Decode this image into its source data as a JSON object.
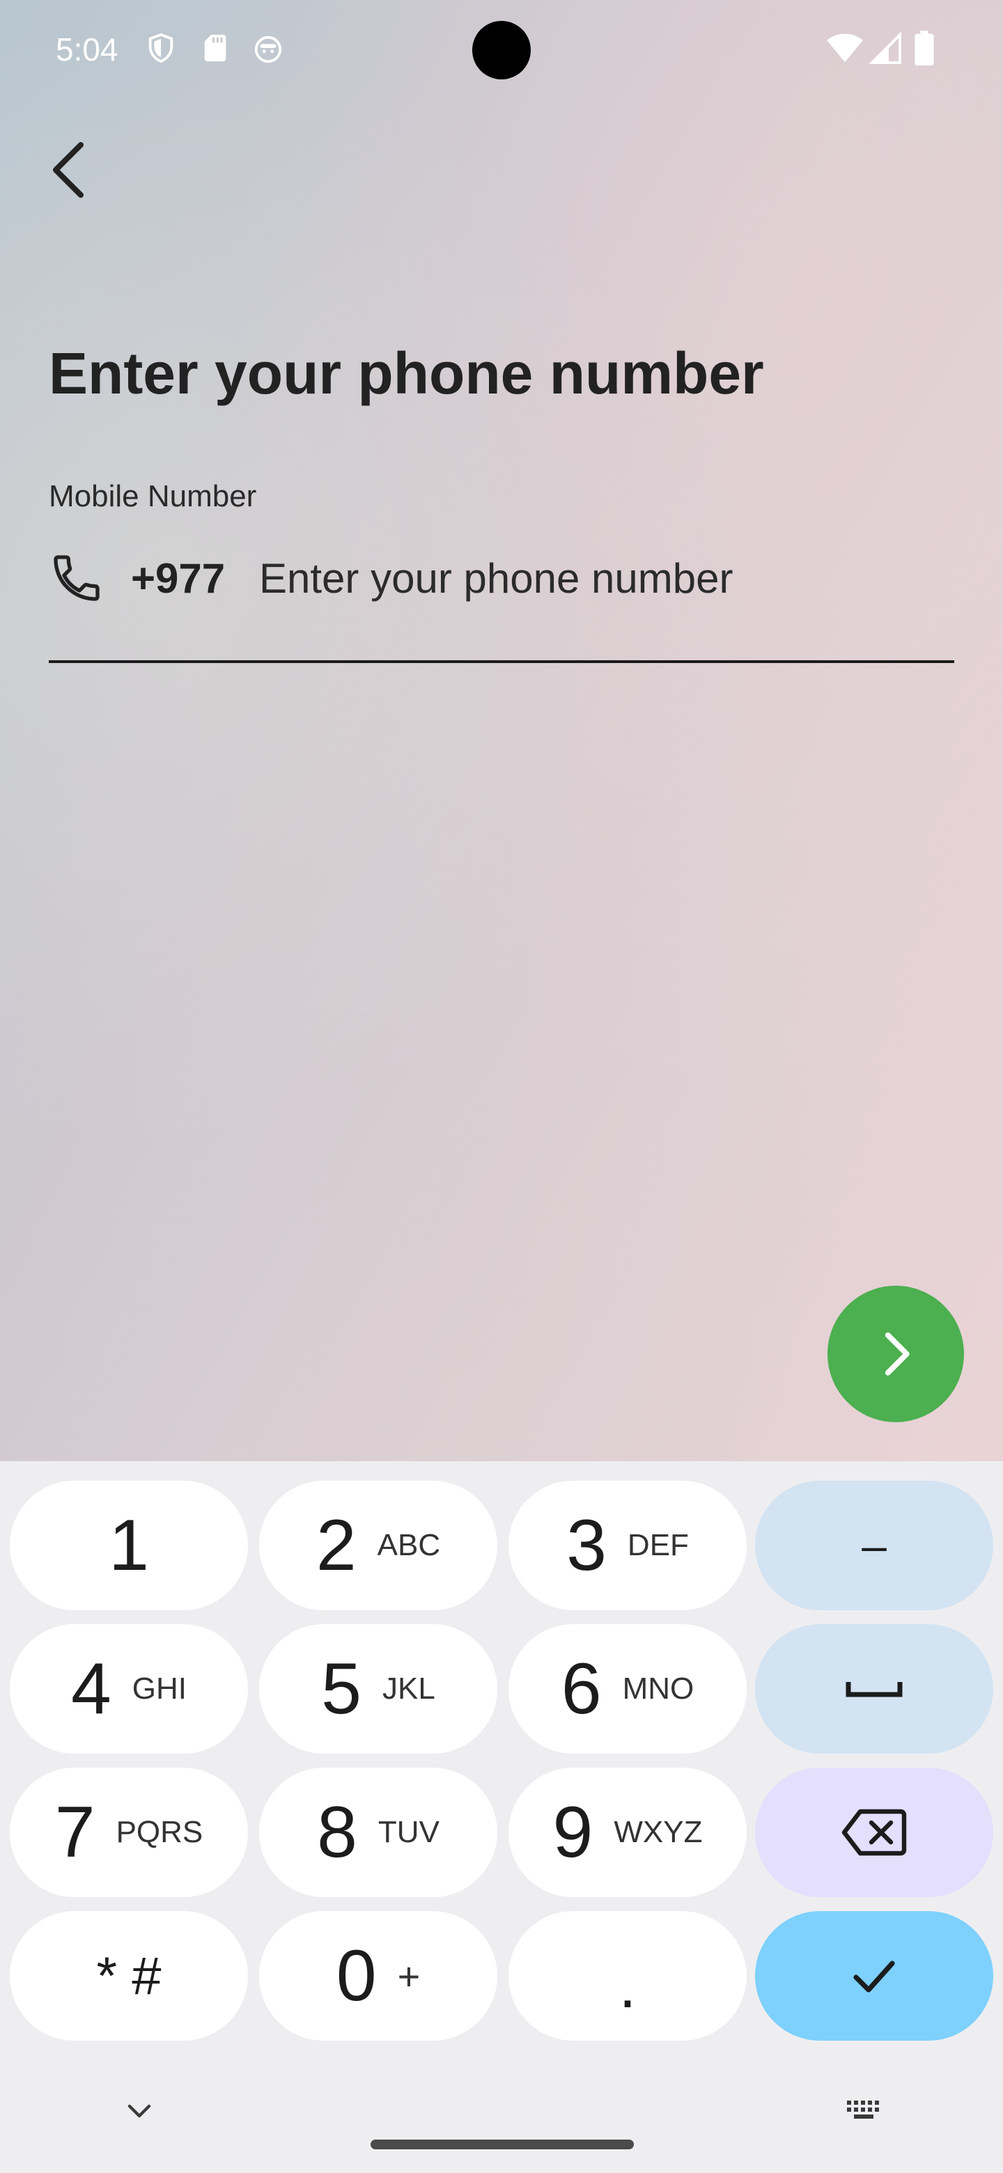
{
  "status_bar": {
    "time": "5:04",
    "icons_left": [
      "vpn-shield-icon",
      "sd-card-icon",
      "android-face-icon"
    ],
    "icons_right": [
      "wifi-icon",
      "cell-signal-icon",
      "battery-icon"
    ]
  },
  "header": {
    "back_icon": "chevron-left-icon"
  },
  "page": {
    "title": "Enter your phone number",
    "field_label": "Mobile Number",
    "country_code": "+977",
    "input_value": "",
    "input_placeholder": "Enter your phone number",
    "phone_icon": "phone-icon"
  },
  "fab": {
    "icon": "chevron-right-icon",
    "color": "#4caf50"
  },
  "keyboard": {
    "rows": [
      [
        {
          "num": "1",
          "letters": ""
        },
        {
          "num": "2",
          "letters": "ABC"
        },
        {
          "num": "3",
          "letters": "DEF"
        },
        {
          "sym": "–"
        }
      ],
      [
        {
          "num": "4",
          "letters": "GHI"
        },
        {
          "num": "5",
          "letters": "JKL"
        },
        {
          "num": "6",
          "letters": "MNO"
        },
        {
          "sym": "space"
        }
      ],
      [
        {
          "num": "7",
          "letters": "PQRS"
        },
        {
          "num": "8",
          "letters": "TUV"
        },
        {
          "num": "9",
          "letters": "WXYZ"
        },
        {
          "sym": "backspace"
        }
      ],
      [
        {
          "sym": "* #"
        },
        {
          "num": "0",
          "letters": "+"
        },
        {
          "sym": "."
        },
        {
          "sym": "done"
        }
      ]
    ],
    "dash_label": "–",
    "star_hash_label": "* #",
    "dot_label": ".",
    "colors": {
      "function_key": "#d3e3f2",
      "backspace_key": "#e3dffc",
      "done_key": "#7dd1fc",
      "keyboard_bg": "#eeeef1"
    }
  },
  "nav": {
    "hide_keyboard_icon": "chevron-down-icon",
    "keyboard_switch_icon": "keyboard-icon"
  }
}
